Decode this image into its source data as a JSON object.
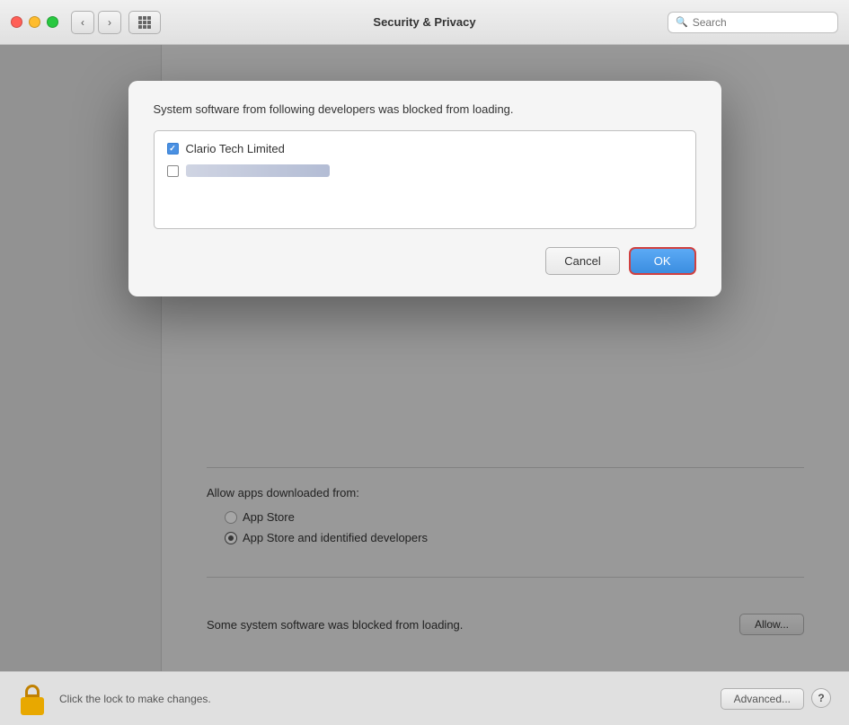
{
  "titlebar": {
    "title": "Security & Privacy",
    "search_placeholder": "Search",
    "back_label": "‹",
    "forward_label": "›"
  },
  "modal": {
    "title": "System software from following developers was blocked from loading.",
    "item1": {
      "label": "Clario Tech Limited",
      "checked": true
    },
    "item2": {
      "label": "",
      "checked": false
    },
    "cancel_label": "Cancel",
    "ok_label": "OK"
  },
  "main": {
    "allow_label": "Allow apps downloaded from:",
    "radio1_label": "App Store",
    "radio2_label": "App Store and identified developers",
    "divider": true,
    "blocked_text": "Some system software was blocked from loading.",
    "allow_btn_label": "Allow..."
  },
  "bottom": {
    "lock_label": "Click the lock to make changes.",
    "advanced_label": "Advanced...",
    "help_label": "?"
  }
}
